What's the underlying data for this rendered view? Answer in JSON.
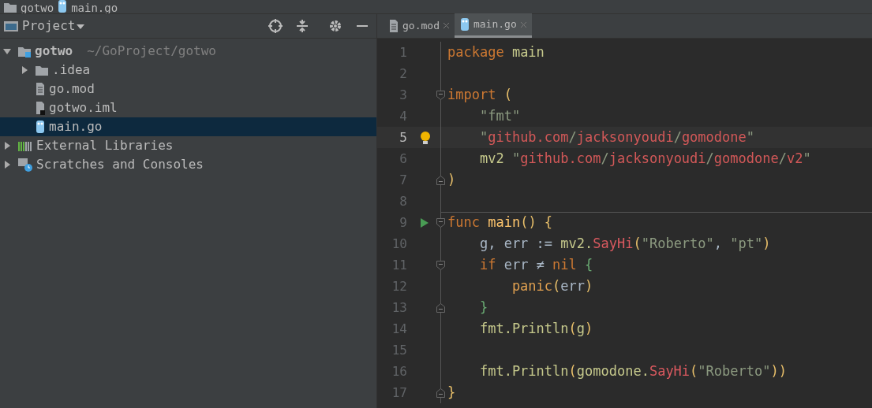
{
  "breadcrumb": [
    {
      "label": "gotwo",
      "kind": "folder"
    },
    {
      "label": "main.go",
      "kind": "gofile"
    }
  ],
  "project_panel": {
    "title": "Project",
    "tree": [
      {
        "label": "gotwo",
        "kind": "module",
        "hint": "~/GoProject/gotwo",
        "expanded": true,
        "selected": false,
        "children": [
          {
            "label": ".idea",
            "kind": "folder",
            "expanded": false,
            "selected": false
          },
          {
            "label": "go.mod",
            "kind": "textfile",
            "selected": false
          },
          {
            "label": "gotwo.iml",
            "kind": "imlfile",
            "selected": false
          },
          {
            "label": "main.go",
            "kind": "gofile",
            "selected": true
          }
        ]
      },
      {
        "label": "External Libraries",
        "kind": "libraries",
        "expanded": false,
        "selected": false
      },
      {
        "label": "Scratches and Consoles",
        "kind": "scratches",
        "expanded": false,
        "selected": false
      }
    ]
  },
  "editor": {
    "tabs": [
      {
        "label": "go.mod",
        "kind": "textfile",
        "selected": false
      },
      {
        "label": "main.go",
        "kind": "gofile",
        "selected": true
      }
    ],
    "lines": [
      {
        "number": "1",
        "current": false,
        "tokens": [
          {
            "kind": "keyword",
            "text": "package"
          },
          {
            "kind": "pkg",
            "text": " main"
          }
        ]
      },
      {
        "number": "2",
        "current": false
      },
      {
        "number": "3",
        "current": false,
        "fold": {
          "kind": "start"
        },
        "tokens": [
          {
            "kind": "keyword",
            "text": "import"
          },
          {
            "kind": "paren",
            "text": " ("
          }
        ]
      },
      {
        "number": "4",
        "current": false,
        "tokens": [
          {
            "kind": "string",
            "text": "    \"fmt\""
          }
        ]
      },
      {
        "number": "5",
        "current": true,
        "gutter_icon": {
          "kind": "bulb"
        },
        "tokens": [
          {
            "kind": "string",
            "text": "    \""
          },
          {
            "kind": "path",
            "text": "github.com"
          },
          {
            "kind": "string",
            "text": "/"
          },
          {
            "kind": "path",
            "text": "jacksonyoudi"
          },
          {
            "kind": "string",
            "text": "/"
          },
          {
            "kind": "path",
            "text": "gomodone"
          },
          {
            "kind": "string",
            "text": "\""
          }
        ]
      },
      {
        "number": "6",
        "current": false,
        "tokens": [
          {
            "kind": "pkg",
            "text": "    mv2"
          },
          {
            "kind": "string",
            "text": " \""
          },
          {
            "kind": "path",
            "text": "github.com"
          },
          {
            "kind": "string",
            "text": "/"
          },
          {
            "kind": "path",
            "text": "jacksonyoudi"
          },
          {
            "kind": "string",
            "text": "/"
          },
          {
            "kind": "path",
            "text": "gomodone"
          },
          {
            "kind": "string",
            "text": "/"
          },
          {
            "kind": "path",
            "text": "v2"
          },
          {
            "kind": "string",
            "text": "\""
          }
        ]
      },
      {
        "number": "7",
        "current": false,
        "fold": {
          "kind": "end"
        },
        "tokens": [
          {
            "kind": "paren",
            "text": ")"
          }
        ]
      },
      {
        "number": "8",
        "current": false
      },
      {
        "number": "9",
        "current": false,
        "separator": true,
        "fold": {
          "kind": "start"
        },
        "gutter_icon": {
          "kind": "run"
        },
        "tokens": [
          {
            "kind": "keyword",
            "text": "func"
          },
          {
            "kind": "func",
            "text": " main"
          },
          {
            "kind": "paren",
            "text": "() {"
          }
        ]
      },
      {
        "number": "10",
        "current": false,
        "tokens": [
          {
            "kind": "plain",
            "text": "    g, err := "
          },
          {
            "kind": "pkg",
            "text": "mv2."
          },
          {
            "kind": "call",
            "text": "SayHi"
          },
          {
            "kind": "paren",
            "text": "("
          },
          {
            "kind": "string",
            "text": "\"Roberto\""
          },
          {
            "kind": "plain",
            "text": ", "
          },
          {
            "kind": "string",
            "text": "\"pt\""
          },
          {
            "kind": "paren",
            "text": ")"
          }
        ]
      },
      {
        "number": "11",
        "current": false,
        "fold": {
          "kind": "start"
        },
        "tokens": [
          {
            "kind": "keyword",
            "text": "    if"
          },
          {
            "kind": "plain",
            "text": " err ≠ "
          },
          {
            "kind": "keyword",
            "text": "nil"
          },
          {
            "kind": "brace",
            "text": " {"
          }
        ]
      },
      {
        "number": "12",
        "current": false,
        "tokens": [
          {
            "kind": "builtin",
            "text": "        panic"
          },
          {
            "kind": "paren",
            "text": "("
          },
          {
            "kind": "plain",
            "text": "err"
          },
          {
            "kind": "paren",
            "text": ")"
          }
        ]
      },
      {
        "number": "13",
        "current": false,
        "fold": {
          "kind": "end"
        },
        "tokens": [
          {
            "kind": "brace",
            "text": "    }"
          }
        ]
      },
      {
        "number": "14",
        "current": false,
        "tokens": [
          {
            "kind": "pkg",
            "text": "    fmt.Println"
          },
          {
            "kind": "paren",
            "text": "("
          },
          {
            "kind": "pkg",
            "text": "g"
          },
          {
            "kind": "paren",
            "text": ")"
          }
        ]
      },
      {
        "number": "15",
        "current": false
      },
      {
        "number": "16",
        "current": false,
        "tokens": [
          {
            "kind": "pkg",
            "text": "    fmt.Println"
          },
          {
            "kind": "paren",
            "text": "("
          },
          {
            "kind": "pkg",
            "text": "gomodone."
          },
          {
            "kind": "call",
            "text": "SayHi"
          },
          {
            "kind": "paren",
            "text": "("
          },
          {
            "kind": "string",
            "text": "\"Roberto\""
          },
          {
            "kind": "paren",
            "text": "))"
          }
        ]
      },
      {
        "number": "17",
        "current": false,
        "fold": {
          "kind": "end"
        },
        "tokens": [
          {
            "kind": "paren",
            "text": "}"
          }
        ]
      }
    ]
  }
}
